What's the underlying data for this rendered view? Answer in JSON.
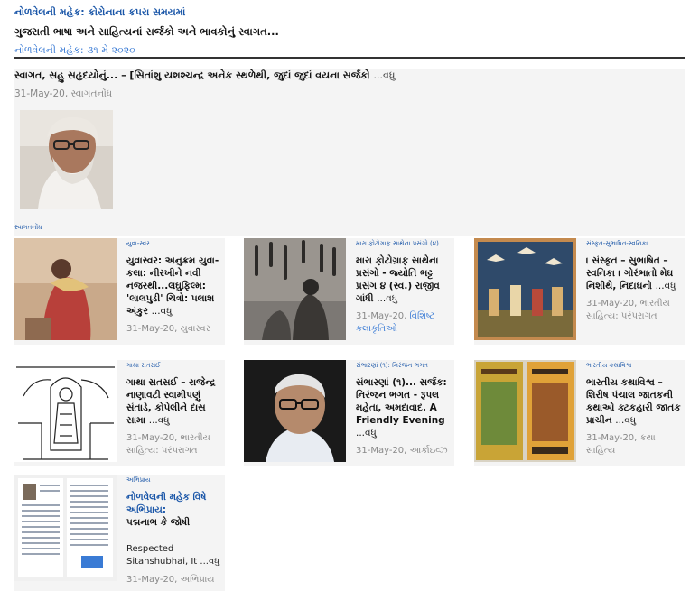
{
  "site": {
    "title": "નોળવેલની મહેક: કોરોનાના કપરા સમયમાં",
    "tagline": "ગુજરાતી ભાષા અને સાહિત્યનાં સર્જકો અને ભાવકોનું સ્વાગત...",
    "issue": "નોળવેલની મહેક: ૩૧ મે ૨૦૨૦"
  },
  "featured": {
    "title": "સ્વાગત, સહુ સહૃદયોનું... – [સિતાંશુ યશશ્ચન્દ્ર અનેક સ્થળેથી, જુદાં જુદાં વયના સર્જકો",
    "more": "...વધુ",
    "meta": "31-May-20, સ્વાગતનોંધ",
    "category": "સ્વાગતનોંધ",
    "photo_icon": "portrait-icon"
  },
  "cards": [
    {
      "category": "યુવા-સ્વર",
      "title": "યુવાસ્વર: અનુક્રમ યુવા-કલા: નીરખીને નવી નજરથી...લઘુફિલ્મ: 'લાલપુડી' ચિત્રો: પલાશ અંકુર",
      "more": "...વધુ",
      "date": "31-May-20, ",
      "section": "યુવાસ્વર",
      "image_icon": "woman-painting-icon"
    },
    {
      "category": "મારા ફોટોગ્રાફ સાથેના પ્રસંગો (૪)",
      "title": "મારા ફોટોગ્રાફ સાથેના પ્રસંગો - જ્યોતિ ભટ્ટ પ્રસંગ ૪ (સ્વ.) રાજીવ ગાંધી",
      "more": "...વધુ",
      "date": "31-May-20, ",
      "section": "વિશિષ્ટ કલાકૃતિઓ",
      "image_icon": "photograph-icon"
    },
    {
      "category": "સંસ્કૃત-સુભાષિત-સ્વનિકા",
      "title": "। સંસ્કૃત – સુભાષિત – સ્વનિકા । ગોરંભાતો મેઘ નિશીથે, નિદાઘનો",
      "more": "...વધુ",
      "date": "31-May-20, ",
      "section": "ભારતીય સાહિત્ય: પરંપરાગત",
      "image_icon": "miniature-painting-icon"
    },
    {
      "category": "ગાથા સતસઈ",
      "title": "ગાથા સતસઈ – રાજેન્દ્ર નાણાવટી સ્વામીપણું સંતાડે, કોપેલીને દાસ સામા",
      "more": "...વધુ",
      "date": "31-May-20, ",
      "section": "ભારતીય સાહિત્ય: પરંપરાગત",
      "image_icon": "line-drawing-icon"
    },
    {
      "category": "સંભારણાં (૧): નિરંજન ભગત",
      "title": "સંભારણાં (૧)... સર્જક: નિરંજન ભગત - રૂપલ મહેતા, અમદાવાદ. A Friendly Evening",
      "more": "...વધુ",
      "date": "31-May-20, ",
      "section": "આર્કાઇવ્ઝ",
      "image_icon": "portrait-icon"
    },
    {
      "category": "ભારતીય કથાવિશ્વ",
      "title": "ભારતીય કથાવિશ્વ – શિરીષ પંચાલ જાતકની કથાઓ ક્ટકહારી જાતક પ્રાચીન",
      "more": "...વધુ",
      "date": "31-May-20, ",
      "section": "કથા સાહિત્ય",
      "image_icon": "book-cover-icon"
    },
    {
      "category": "અભિપ્રાય",
      "title": "નોળવેલની મહેક વિષે અભિપ્રાય:",
      "subtitle": "પદ્મનાભ કે જોષી",
      "body": "Respected Sitanshubhai, It",
      "more": "...વધુ",
      "date": "31-May-20, ",
      "section": "અભિપ્રાય",
      "image_icon": "document-scan-icon"
    }
  ]
}
